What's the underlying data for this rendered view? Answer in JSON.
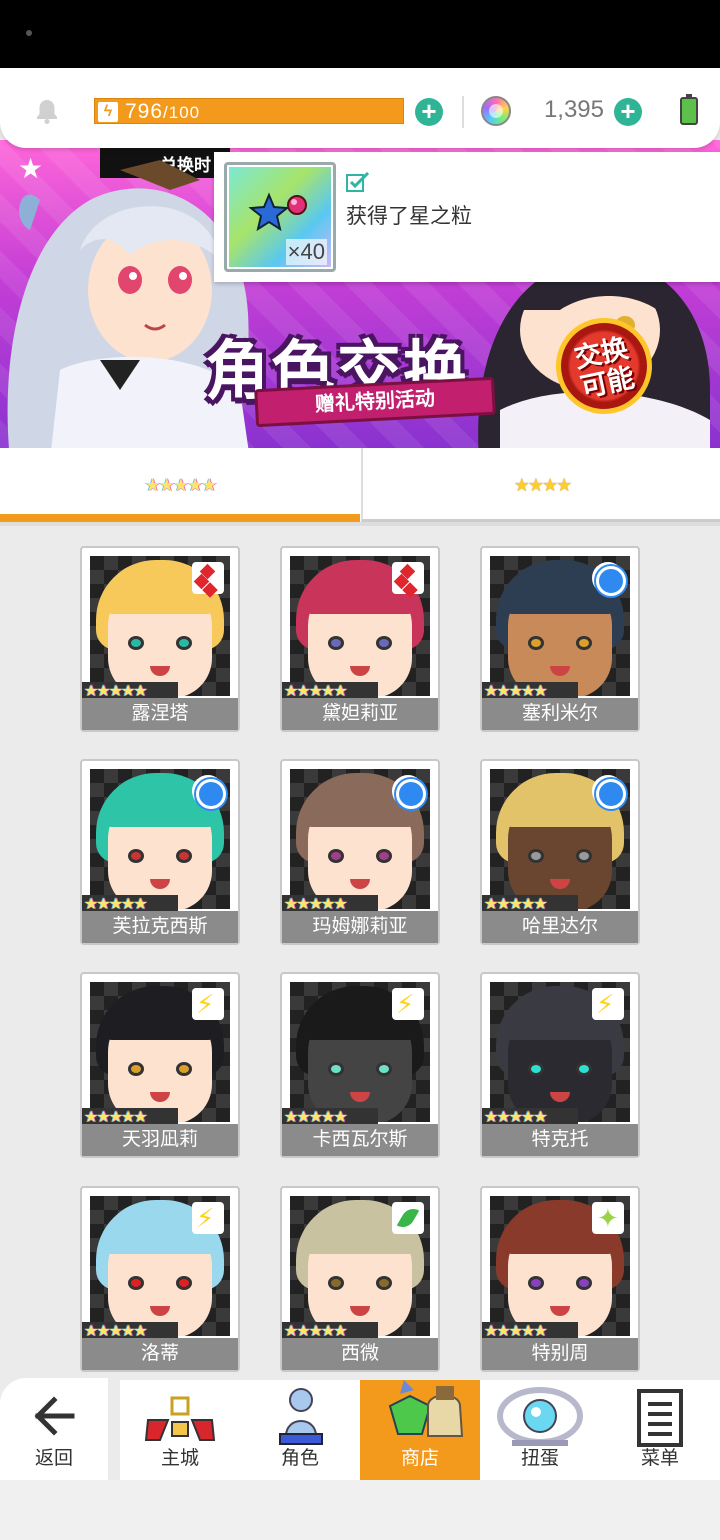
{
  "topbar": {
    "stamina_current": "796",
    "stamina_max": "/100",
    "gems": "1,395"
  },
  "banner": {
    "label": "兑换时",
    "title": "角色交换",
    "subtitle": "赠礼特别活动",
    "badge_line1": "交换",
    "badge_line2": "可能"
  },
  "toast": {
    "quantity": "×40",
    "message": "获得了星之粒"
  },
  "tabs": [
    {
      "label": "★★★★★"
    },
    {
      "label": "★★★★"
    }
  ],
  "cards": [
    {
      "name": "露涅塔",
      "stars": "★★★★★",
      "attribute": "fire",
      "hair": "#f7c95a",
      "skin": "#fde2cf",
      "eye": "#2ab8a0"
    },
    {
      "name": "黛妲莉亚",
      "stars": "★★★★★",
      "attribute": "fire",
      "hair": "#c9345a",
      "skin": "#fde2cf",
      "eye": "#6a6ab8"
    },
    {
      "name": "塞利米尔",
      "stars": "★★★★★",
      "attribute": "water",
      "hair": "#2d3e52",
      "skin": "#c98a5a",
      "eye": "#d9a02a"
    },
    {
      "name": "芙拉克西斯",
      "stars": "★★★★★",
      "attribute": "water",
      "hair": "#2ec4a8",
      "skin": "#fde2cf",
      "eye": "#c33"
    },
    {
      "name": "玛姆娜莉亚",
      "stars": "★★★★★",
      "attribute": "water",
      "hair": "#8a6a5a",
      "skin": "#fde2cf",
      "eye": "#a0408a"
    },
    {
      "name": "哈里达尔",
      "stars": "★★★★★",
      "attribute": "water",
      "hair": "#e3c36a",
      "skin": "#6a4630",
      "eye": "#999"
    },
    {
      "name": "天羽凪莉",
      "stars": "★★★★★",
      "attribute": "thunder",
      "hair": "#1e1e22",
      "skin": "#fde2cf",
      "eye": "#d9a02a"
    },
    {
      "name": "卡西瓦尔斯",
      "stars": "★★★★★",
      "attribute": "thunder",
      "hair": "#1a1a1a",
      "skin": "#444",
      "eye": "#6fe0c8"
    },
    {
      "name": "特克托",
      "stars": "★★★★★",
      "attribute": "thunder",
      "hair": "#3a3a42",
      "skin": "#2a2a30",
      "eye": "#2ee0d0"
    },
    {
      "name": "洛蒂",
      "stars": "★★★★★",
      "attribute": "thunder",
      "hair": "#9ad8ee",
      "skin": "#fde2cf",
      "eye": "#d22"
    },
    {
      "name": "西微",
      "stars": "★★★★★",
      "attribute": "wind",
      "hair": "#c9c2a0",
      "skin": "#fde2cf",
      "eye": "#8a6a2a"
    },
    {
      "name": "特别周",
      "stars": "★★★★★",
      "attribute": "light",
      "hair": "#8a3a2a",
      "skin": "#fde2cf",
      "eye": "#8a40c0"
    }
  ],
  "nav": [
    {
      "label": "返回",
      "icon": "back-arrow-icon"
    },
    {
      "label": "主城",
      "icon": "home-castle-icon"
    },
    {
      "label": "角色",
      "icon": "character-icon"
    },
    {
      "label": "商店",
      "icon": "shop-icon"
    },
    {
      "label": "扭蛋",
      "icon": "gacha-icon"
    },
    {
      "label": "菜单",
      "icon": "menu-icon"
    }
  ],
  "colors": {
    "accent": "#f39a1c",
    "plus_button": "#2fb596",
    "card_label": "#8b8b8b"
  }
}
